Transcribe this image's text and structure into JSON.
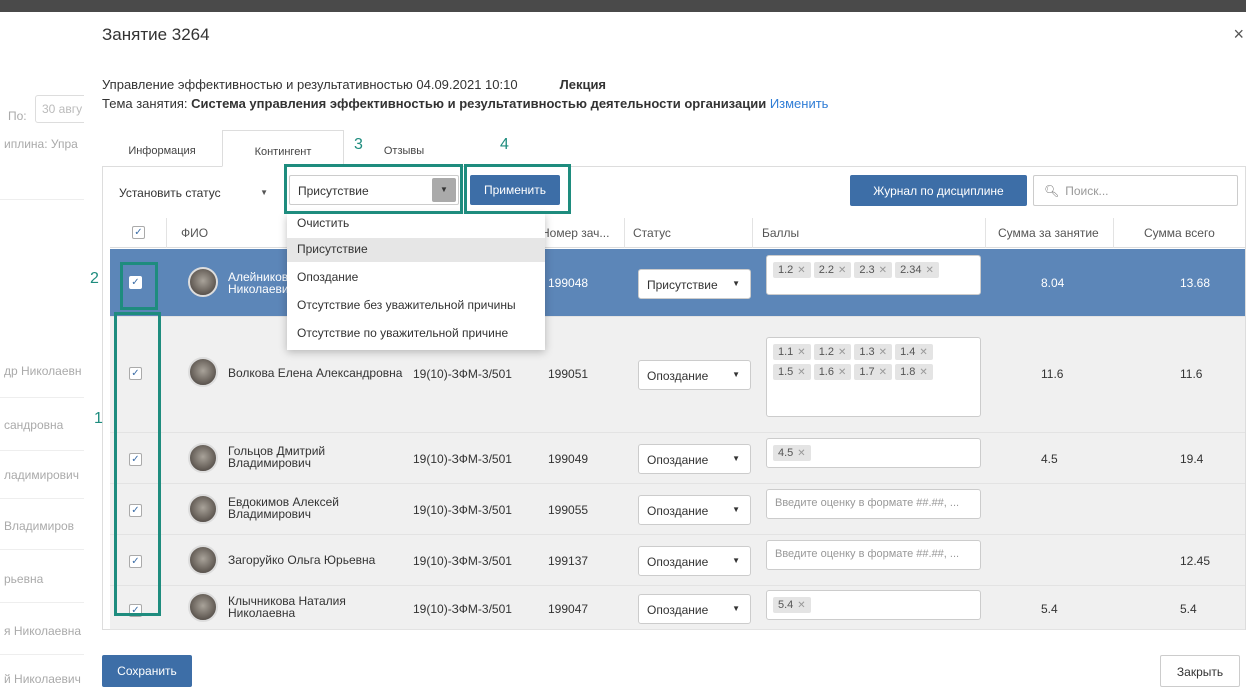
{
  "modal": {
    "title": "Занятие 3264",
    "close_icon": "×",
    "info_line1": "Управление эффективностью и результативностью 04.09.2021 10:10",
    "lesson_kind": "Лекция",
    "topic_label": "Тема занятия: ",
    "topic": "Система управления эффективностью и результативностью деятельности организации",
    "change_link": "Изменить"
  },
  "background": {
    "po_label": "По:",
    "date_box": "30 авгу",
    "discipline_label": "иплина: Упра",
    "names": [
      "др Николаевн",
      "сандровна",
      "ладимирович",
      "Владимиров",
      "рьевна",
      "я Николаевна",
      "й Николаевич"
    ]
  },
  "tabs": [
    {
      "label": "Информация"
    },
    {
      "label": "Контингент"
    },
    {
      "label": "Отзывы"
    }
  ],
  "toolbar": {
    "set_status": "Установить статус",
    "status_value": "Присутствие",
    "apply": "Применить",
    "journal": "Журнал по дисциплине",
    "search_placeholder": "Поиск...",
    "search_icon": "search-icon"
  },
  "dropdown": {
    "options": [
      "Очистить",
      "Присутствие",
      "Опоздание",
      "Отсутствие без уважительной причины",
      "Отсутствие по уважительной причине"
    ],
    "highlighted": "Присутствие"
  },
  "table": {
    "headers": [
      "ФИО",
      "Номер зач...",
      "Статус",
      "Баллы",
      "Сумма за занятие",
      "Сумма всего"
    ],
    "rows": [
      {
        "name1": "Алейников А",
        "name2": "Николаевич",
        "group": "",
        "number": "199048",
        "status": "Присутствие",
        "scores": [
          "1.2",
          "2.2",
          "2.3",
          "2.34"
        ],
        "placeholder": "",
        "sum_lesson": "8.04",
        "sum_total": "13.68"
      },
      {
        "name1": "Волкова Елена Александровна",
        "name2": "",
        "group": "19(10)-ЗФМ-3/501",
        "number": "199051",
        "status": "Опоздание",
        "scores": [
          "1.1",
          "1.2",
          "1.3",
          "1.4",
          "1.5",
          "1.6",
          "1.7",
          "1.8"
        ],
        "placeholder": "",
        "sum_lesson": "11.6",
        "sum_total": "11.6"
      },
      {
        "name1": "Гольцов Дмитрий",
        "name2": "Владимирович",
        "group": "19(10)-ЗФМ-3/501",
        "number": "199049",
        "status": "Опоздание",
        "scores": [
          "4.5"
        ],
        "placeholder": "",
        "sum_lesson": "4.5",
        "sum_total": "19.4"
      },
      {
        "name1": "Евдокимов Алексей",
        "name2": "Владимирович",
        "group": "19(10)-ЗФМ-3/501",
        "number": "199055",
        "status": "Опоздание",
        "scores": [],
        "placeholder": "Введите оценку в формате ##.##, ...",
        "sum_lesson": "",
        "sum_total": ""
      },
      {
        "name1": "Загоруйко Ольга Юрьевна",
        "name2": "",
        "group": "19(10)-ЗФМ-3/501",
        "number": "199137",
        "status": "Опоздание",
        "scores": [],
        "placeholder": "Введите оценку в формате ##.##, ...",
        "sum_lesson": "",
        "sum_total": "12.45"
      },
      {
        "name1": "Клычникова Наталия",
        "name2": "Николаевна",
        "group": "19(10)-ЗФМ-3/501",
        "number": "199047",
        "status": "Опоздание",
        "scores": [
          "5.4"
        ],
        "placeholder": "",
        "sum_lesson": "5.4",
        "sum_total": "5.4"
      }
    ]
  },
  "annotations": [
    "1",
    "2",
    "3",
    "4"
  ],
  "footer": {
    "save": "Сохранить",
    "close": "Закрыть"
  },
  "colors": {
    "accent": "#3d6ea7",
    "selected_row": "#5c86b8",
    "highlight_box": "#1e8c7e"
  }
}
